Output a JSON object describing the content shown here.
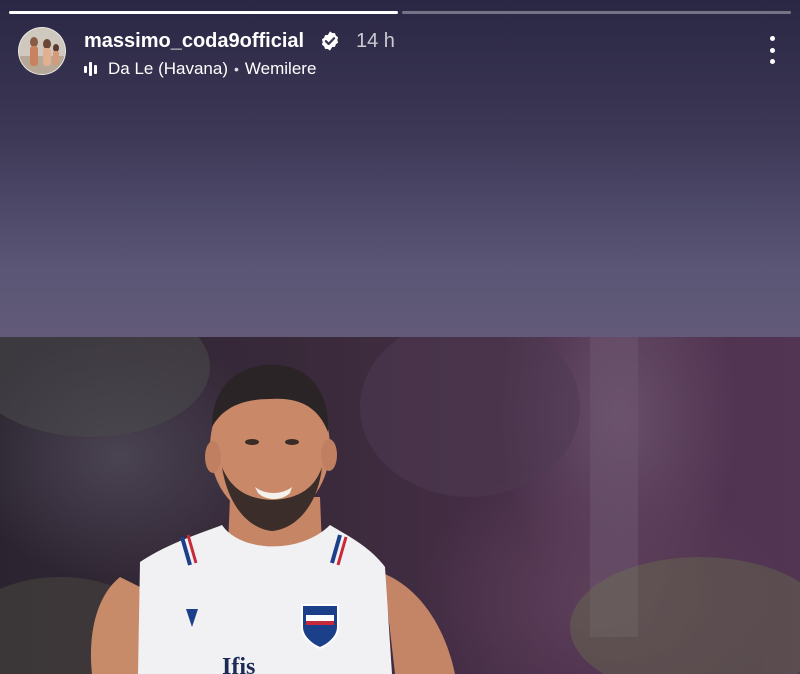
{
  "story": {
    "progress": [
      1.0,
      0.0
    ],
    "author": {
      "username": "massimo_coda9official",
      "verified": true,
      "time_ago": "14 h"
    },
    "music": {
      "icon": "music-bars-icon",
      "song": "Da Le (Havana)",
      "separator": "•",
      "artist": "Wemilere"
    },
    "menu_icon": "more-vertical-icon"
  },
  "photo": {
    "jersey_brand": "Ifis"
  },
  "colors": {
    "text_primary": "#ffffff",
    "progress_active": "#ffffff",
    "verified_badge": "#ffffff"
  }
}
